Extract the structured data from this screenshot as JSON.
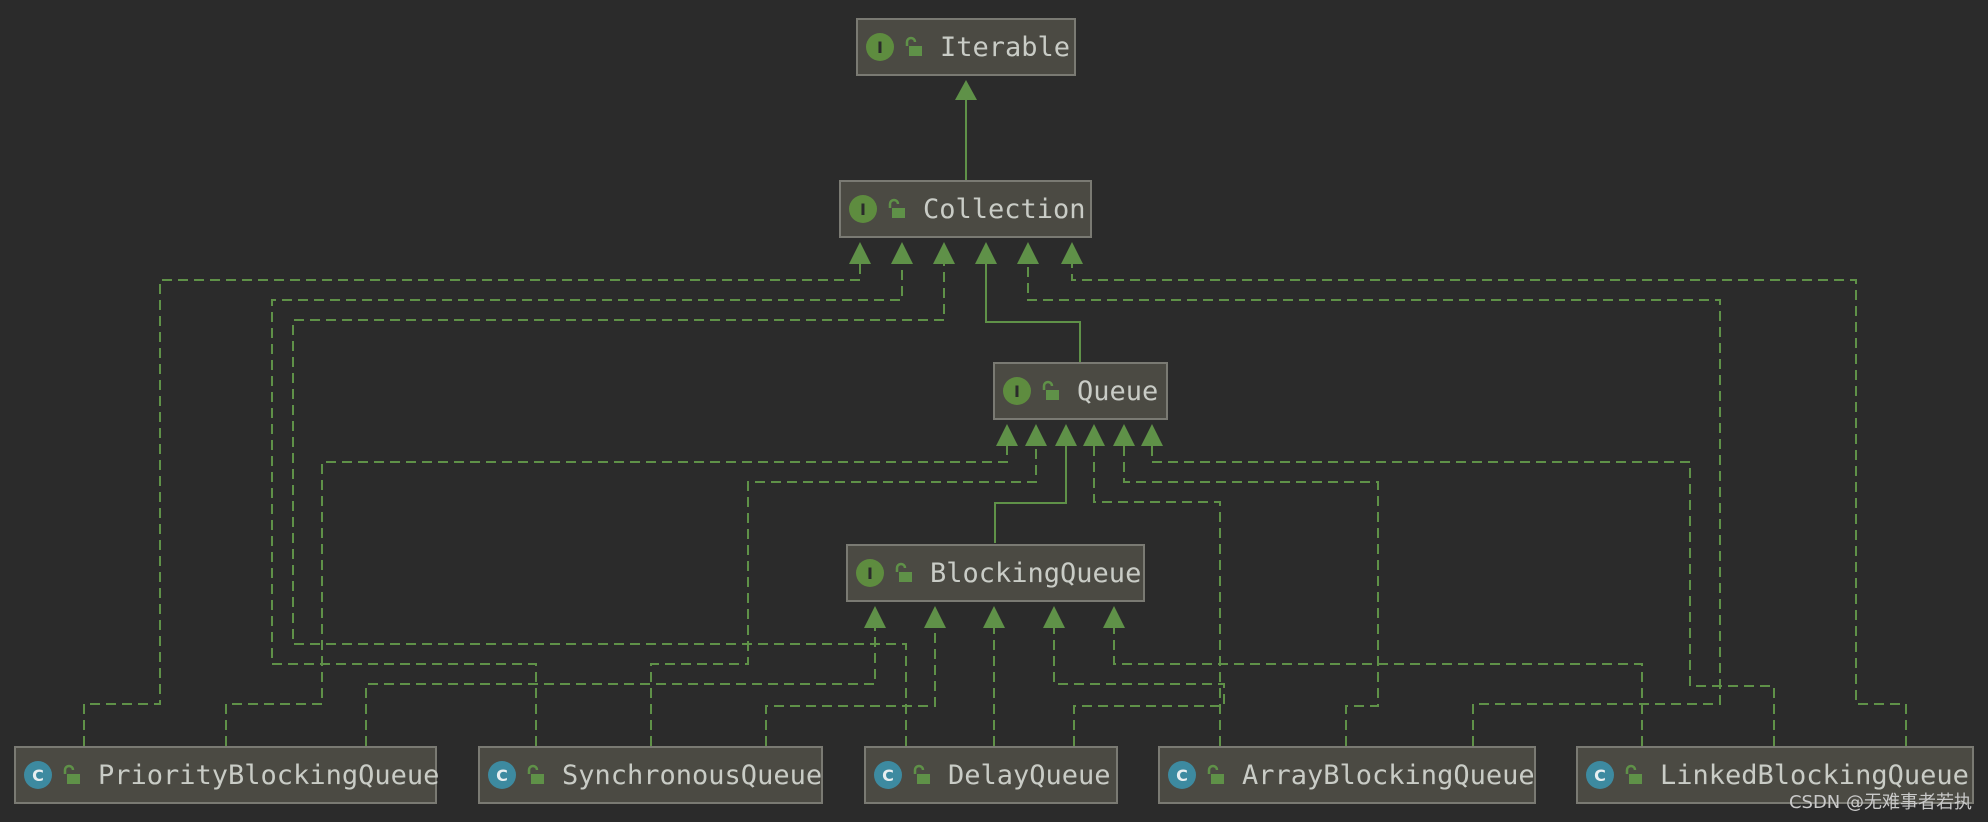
{
  "colors": {
    "background": "#2b2b2b",
    "node_fill": "#4b4a43",
    "node_border": "#7a7a73",
    "edge": "#5f9148",
    "interface_badge": "#5e8c3f",
    "class_badge": "#3d8aa0",
    "text": "#c9ccc6"
  },
  "nodes": {
    "iterable": {
      "badge": "I",
      "label": "Iterable",
      "kind": "interface"
    },
    "collection": {
      "badge": "I",
      "label": "Collection",
      "kind": "interface"
    },
    "queue": {
      "badge": "I",
      "label": "Queue",
      "kind": "interface"
    },
    "blockingqueue": {
      "badge": "I",
      "label": "BlockingQueue",
      "kind": "interface"
    },
    "priorityblockingqueue": {
      "badge": "C",
      "label": "PriorityBlockingQueue",
      "kind": "class"
    },
    "synchronousqueue": {
      "badge": "C",
      "label": "SynchronousQueue",
      "kind": "class"
    },
    "delayqueue": {
      "badge": "C",
      "label": "DelayQueue",
      "kind": "class"
    },
    "arrayblockingqueue": {
      "badge": "C",
      "label": "ArrayBlockingQueue",
      "kind": "class"
    },
    "linkedblockingqueue": {
      "badge": "C",
      "label": "LinkedBlockingQueue",
      "kind": "class"
    }
  },
  "edges": [
    {
      "from": "collection",
      "to": "iterable",
      "style": "extends"
    },
    {
      "from": "queue",
      "to": "collection",
      "style": "extends"
    },
    {
      "from": "blockingqueue",
      "to": "queue",
      "style": "extends"
    },
    {
      "from": "priorityblockingqueue",
      "to": "collection",
      "style": "implements"
    },
    {
      "from": "priorityblockingqueue",
      "to": "queue",
      "style": "implements"
    },
    {
      "from": "priorityblockingqueue",
      "to": "blockingqueue",
      "style": "implements"
    },
    {
      "from": "synchronousqueue",
      "to": "collection",
      "style": "implements"
    },
    {
      "from": "synchronousqueue",
      "to": "queue",
      "style": "implements"
    },
    {
      "from": "synchronousqueue",
      "to": "blockingqueue",
      "style": "implements"
    },
    {
      "from": "delayqueue",
      "to": "collection",
      "style": "implements"
    },
    {
      "from": "delayqueue",
      "to": "queue",
      "style": "implements"
    },
    {
      "from": "delayqueue",
      "to": "blockingqueue",
      "style": "implements"
    },
    {
      "from": "arrayblockingqueue",
      "to": "queue",
      "style": "implements"
    },
    {
      "from": "arrayblockingqueue",
      "to": "blockingqueue",
      "style": "implements"
    },
    {
      "from": "linkedblockingqueue",
      "to": "collection",
      "style": "implements"
    },
    {
      "from": "linkedblockingqueue",
      "to": "queue",
      "style": "implements"
    },
    {
      "from": "linkedblockingqueue",
      "to": "blockingqueue",
      "style": "implements"
    }
  ],
  "watermark": "CSDN @无难事者若执"
}
